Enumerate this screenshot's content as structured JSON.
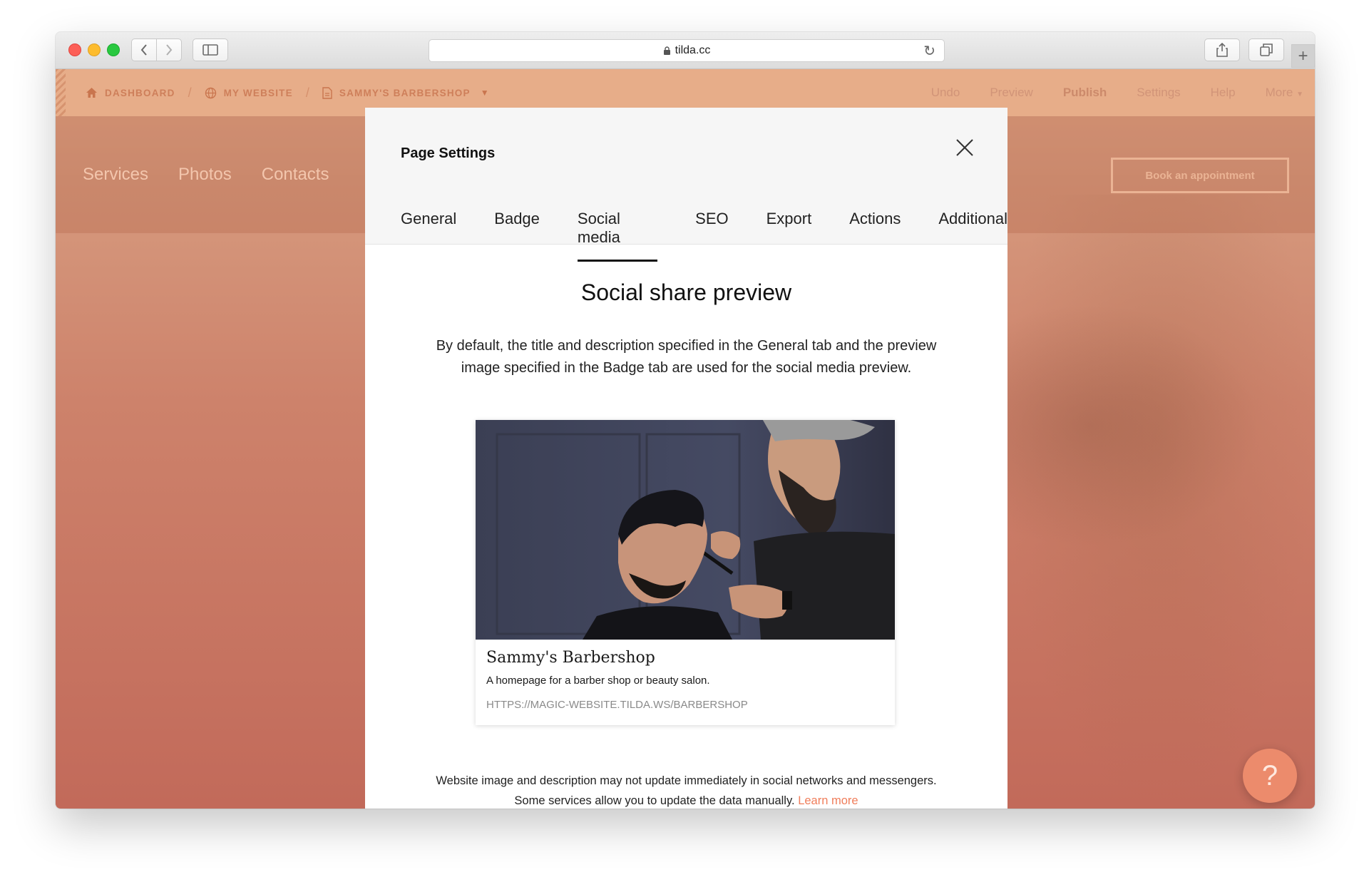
{
  "browser": {
    "url": "tilda.cc",
    "icons": {
      "back": "chevron-left-icon",
      "forward": "chevron-right-icon",
      "sidebar": "sidebar-icon",
      "share": "share-icon",
      "tabs": "tabs-icon",
      "new_tab": "plus-icon",
      "reload": "reload-icon",
      "lock": "lock-icon"
    }
  },
  "tilda_bar": {
    "breadcrumbs": [
      {
        "label": "DASHBOARD",
        "icon": "home-icon"
      },
      {
        "label": "MY WEBSITE",
        "icon": "globe-icon"
      },
      {
        "label": "SAMMY'S BARBERSHOP",
        "icon": "page-icon"
      }
    ],
    "menu": [
      "Undo",
      "Preview",
      "Publish",
      "Settings",
      "Help",
      "More"
    ]
  },
  "site": {
    "nav": [
      "Services",
      "Photos",
      "Contacts"
    ],
    "book_button": "Book an appointment",
    "help_button": "?"
  },
  "modal": {
    "title": "Page Settings",
    "tabs": [
      "General",
      "Badge",
      "Social media",
      "SEO",
      "Export",
      "Actions",
      "Additional"
    ],
    "active_tab": "Social media",
    "section_title": "Social share preview",
    "section_desc": "By default, the title and description specified in the General tab and the preview image specified in the Badge tab are used for the social media preview.",
    "card": {
      "title": "Sammy's Barbershop",
      "description": "A homepage for a barber shop or beauty salon.",
      "url": "HTTPS://MAGIC-WEBSITE.TILDA.WS/BARBERSHOP"
    },
    "footnote": "Website image and description may not update immediately in social networks and messengers. Some services allow you to update the data manually.",
    "footnote_link": "Learn more"
  },
  "colors": {
    "accent": "#f07e5b",
    "page_top": "#e4a98a",
    "page_bottom": "#c26a5a"
  }
}
